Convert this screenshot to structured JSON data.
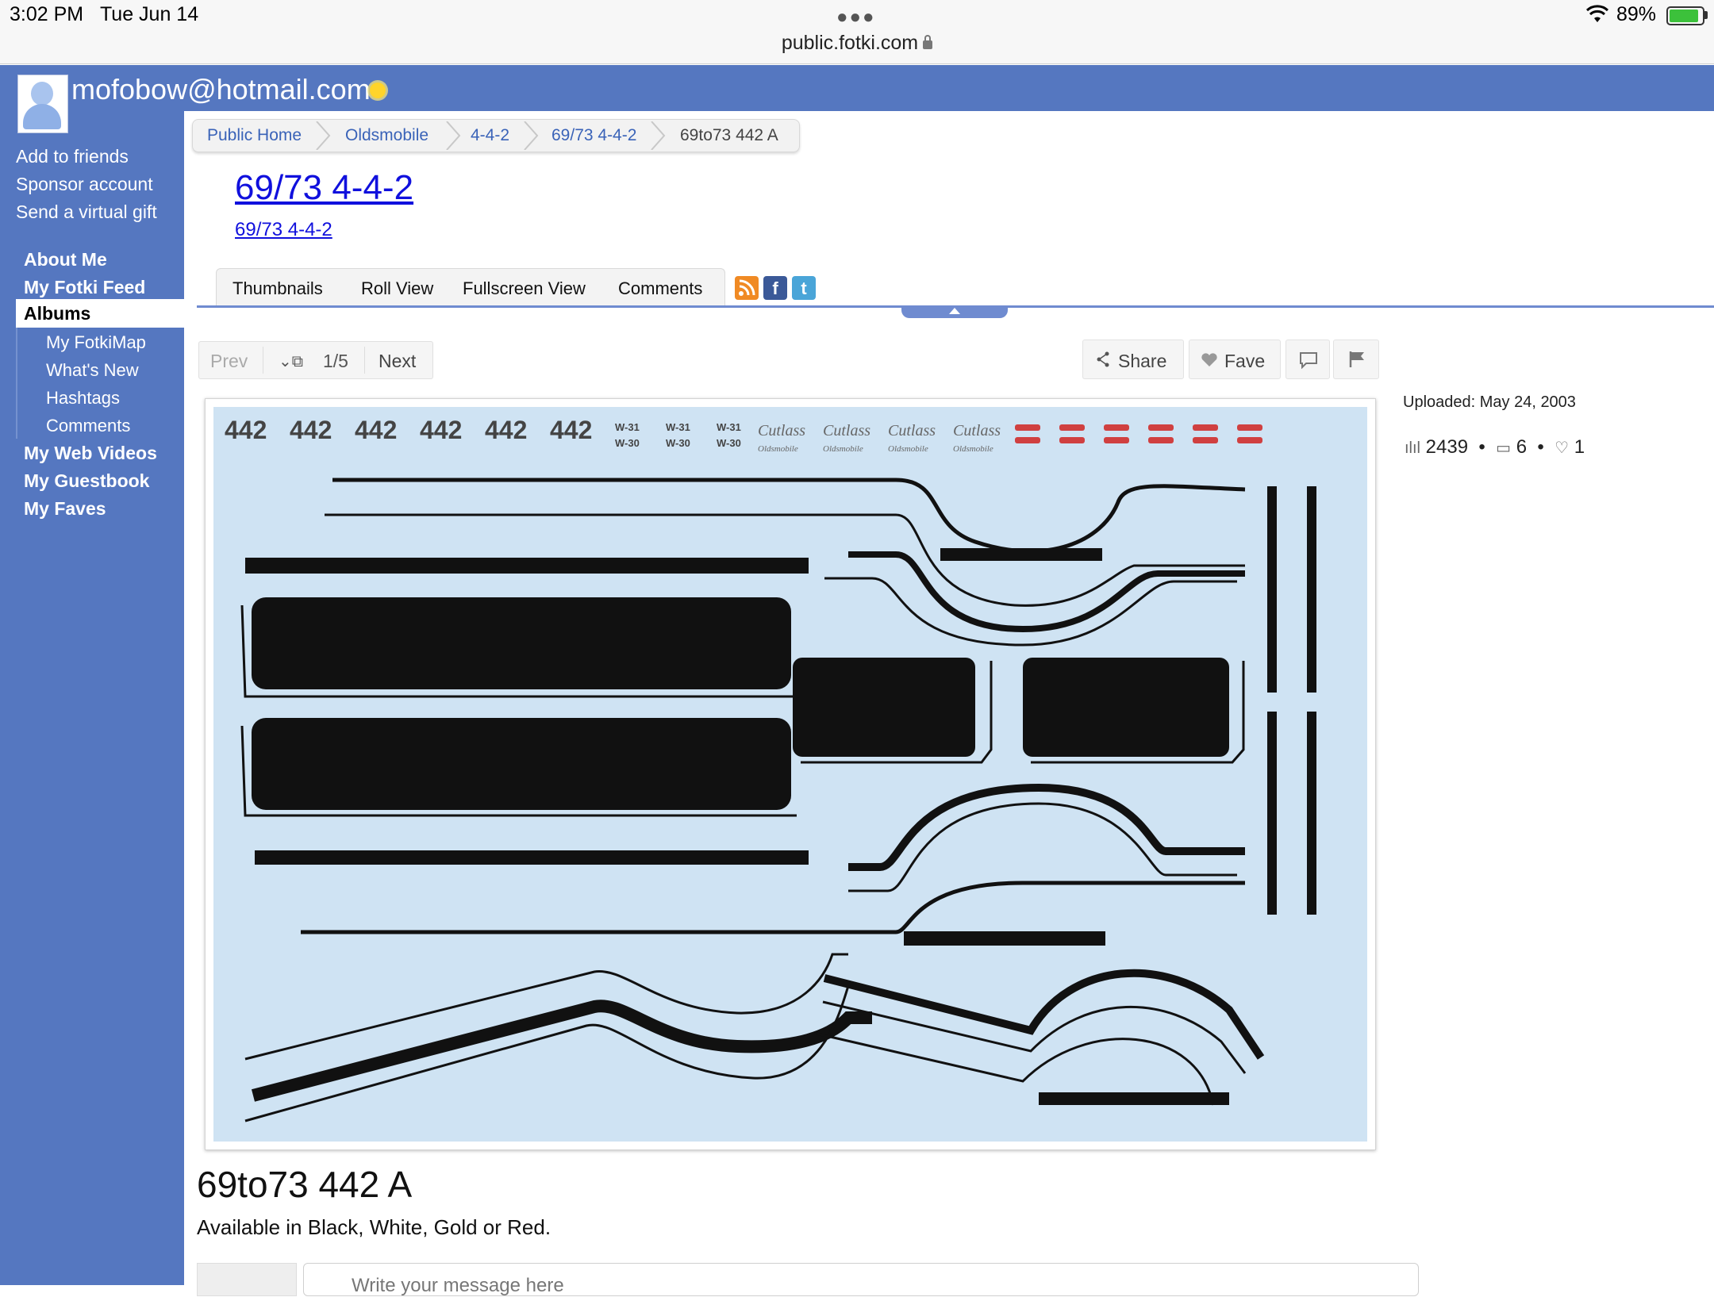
{
  "status_bar": {
    "time": "3:02 PM",
    "date": "Tue Jun 14",
    "url": "public.fotki.com",
    "battery": "89%",
    "battery_level": 0.89
  },
  "header": {
    "username": "mofobow@hotmail.com"
  },
  "sidebar": {
    "actions": [
      "Add to friends",
      "Sponsor account",
      "Send a virtual gift"
    ],
    "nav": {
      "about_me": "About Me",
      "fotki_feed": "My Fotki Feed",
      "albums": "Albums",
      "sub": [
        "My FotkiMap",
        "What's New",
        "Hashtags",
        "Comments"
      ],
      "web_videos": "My Web Videos",
      "guestbook": "My Guestbook",
      "faves": "My Faves"
    }
  },
  "breadcrumb": [
    "Public Home",
    "Oldsmobile",
    "4-4-2",
    "69/73 4-4-2",
    "69to73 442 A"
  ],
  "album": {
    "title": "69/73 4-4-2",
    "subtitle": "69/73 4-4-2"
  },
  "tabs": [
    "Thumbnails",
    "Roll View",
    "Fullscreen View",
    "Comments"
  ],
  "pager": {
    "prev": "Prev",
    "count": "1/5",
    "next": "Next"
  },
  "actions": {
    "share": "Share",
    "fave": "Fave"
  },
  "photo_info": {
    "uploaded": "Uploaded: May 24, 2003",
    "views": "2439",
    "comments": "6",
    "faves": "1"
  },
  "photo": {
    "logos": [
      "442",
      "442",
      "442",
      "442",
      "442",
      "442"
    ],
    "badges_top": [
      "W-31",
      "W-31",
      "W-31"
    ],
    "badges_bottom": [
      "W-30",
      "W-30",
      "W-30"
    ],
    "script_top": [
      "Cutlass",
      "Cutlass",
      "Cutlass",
      "Cutlass"
    ],
    "script_bottom": [
      "Oldsmobile",
      "Oldsmobile",
      "Oldsmobile",
      "Oldsmobile"
    ]
  },
  "caption": {
    "title": "69to73 442 A",
    "description": "Available in Black, White, Gold or Red."
  },
  "comment_box": {
    "placeholder": "Write your message here"
  }
}
